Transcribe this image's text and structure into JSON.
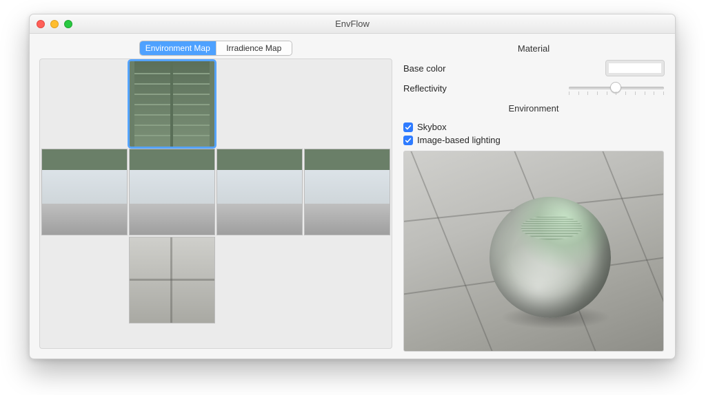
{
  "window": {
    "title": "EnvFlow"
  },
  "tabs": {
    "environment": "Environment Map",
    "irradiance": "Irradience Map",
    "selected": "environment"
  },
  "material": {
    "title": "Material",
    "base_color_label": "Base color",
    "base_color_value": "#ffffff",
    "reflectivity_label": "Reflectivity",
    "reflectivity_value": 0.5
  },
  "environment": {
    "title": "Environment",
    "skybox_label": "Skybox",
    "skybox_checked": true,
    "ibl_label": "Image-based lighting",
    "ibl_checked": true
  },
  "cubemap": {
    "faces": [
      "top",
      "left",
      "front",
      "right",
      "back",
      "bottom"
    ],
    "selected_face": "top",
    "scene_description": "concrete plaza under a steel bridge"
  }
}
